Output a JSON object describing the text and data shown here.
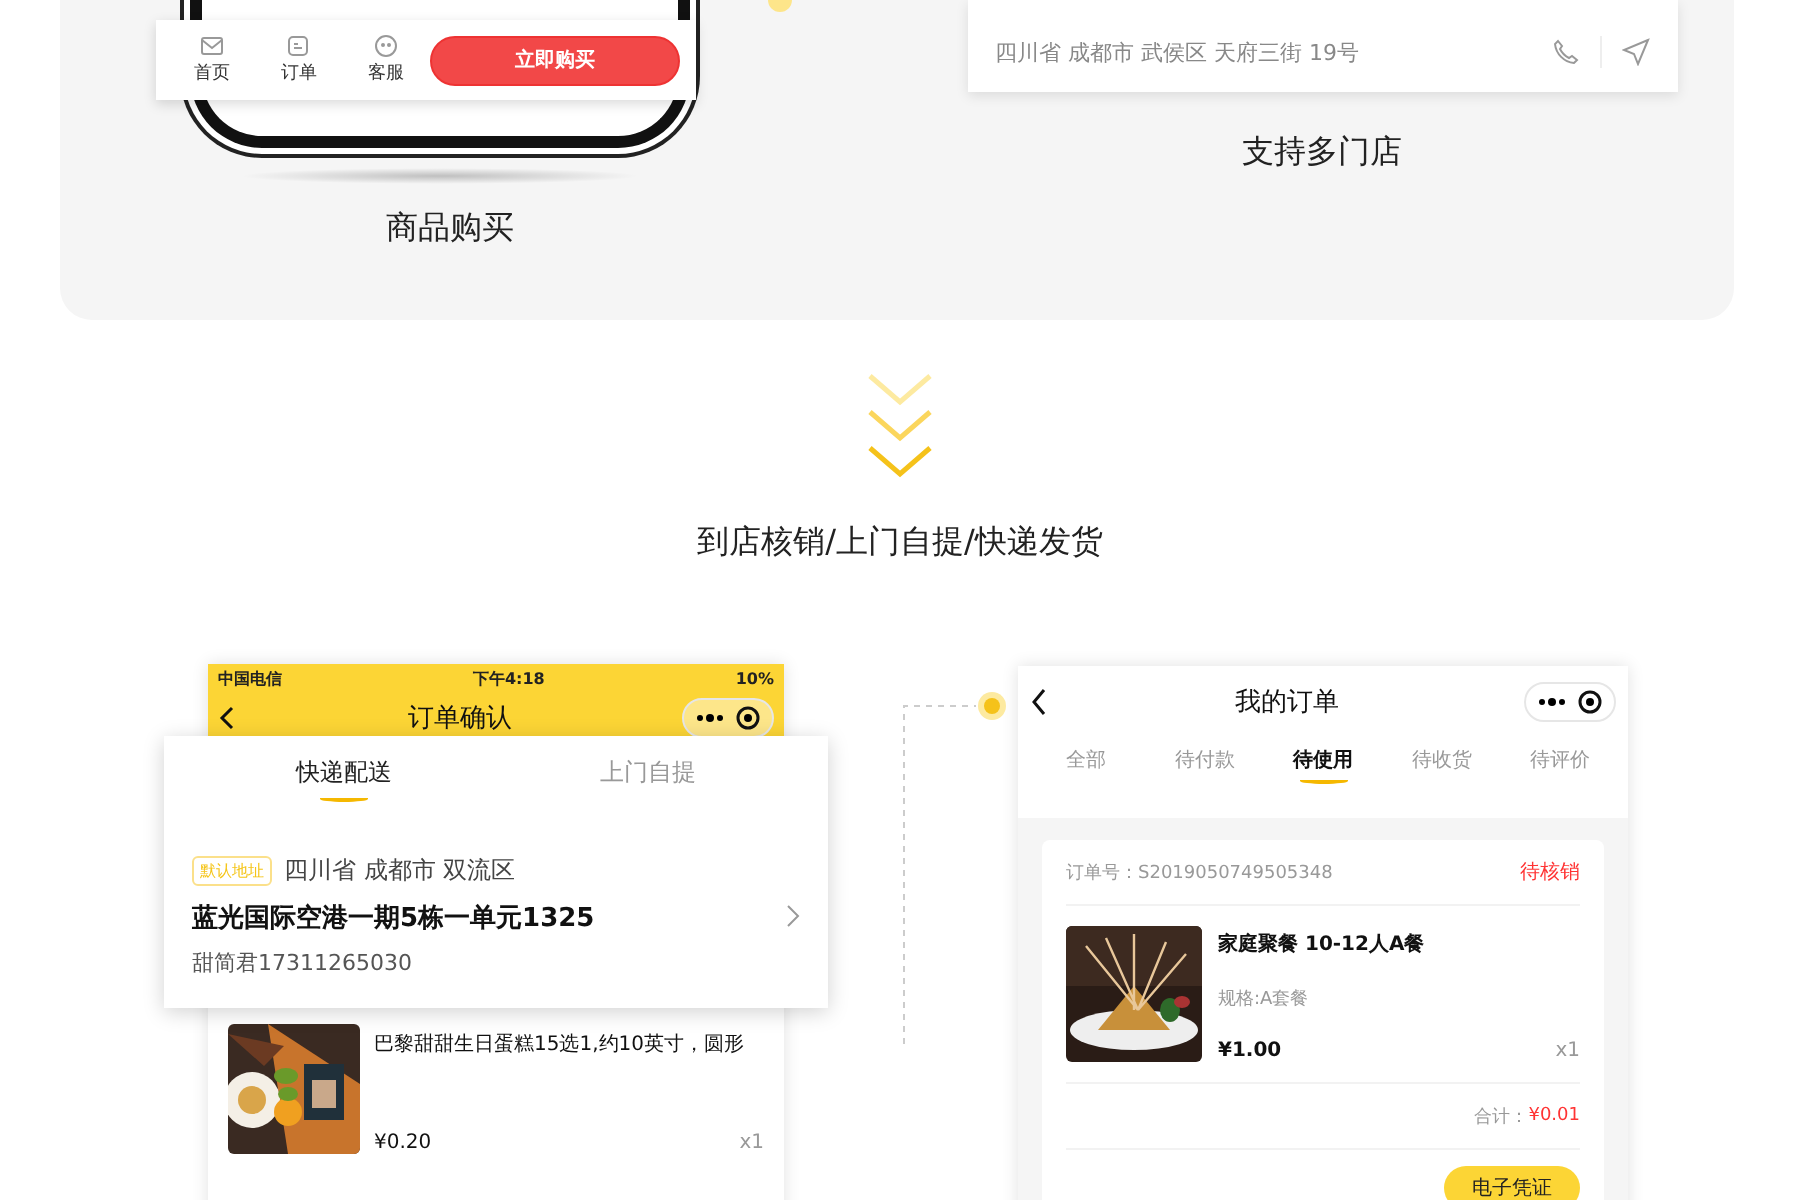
{
  "purchase_bar": {
    "items": [
      {
        "kind": "home",
        "label": "首页"
      },
      {
        "kind": "order",
        "label": "订单"
      },
      {
        "kind": "service",
        "label": "客服"
      }
    ],
    "buy_button": "立即购买"
  },
  "purchase_caption": "商品购买",
  "store_card": {
    "address": "四川省 成都市 武侯区 天府三街 19号"
  },
  "store_caption": "支持多门店",
  "flow_caption": "到店核销/上门自提/快递发货",
  "order_confirm": {
    "status_bar": {
      "carrier": "中国电信",
      "time": "下午4:18",
      "battery": "10%"
    },
    "title": "订单确认",
    "tabs": [
      {
        "label": "快递配送",
        "selected": true
      },
      {
        "label": "上门自提",
        "selected": false
      }
    ],
    "address": {
      "tag": "默认地址",
      "region": "四川省 成都市 双流区",
      "detail": "蓝光国际空港一期5栋一单元1325",
      "contact": "甜简君17311265030"
    },
    "product": {
      "name": "巴黎甜甜生日蛋糕15选1,约10英寸，圆形",
      "price": "¥0.20",
      "quantity": "x1"
    }
  },
  "my_orders": {
    "title": "我的订单",
    "tabs": [
      {
        "label": "全部",
        "selected": false
      },
      {
        "label": "待付款",
        "selected": false
      },
      {
        "label": "待使用",
        "selected": true
      },
      {
        "label": "待收货",
        "selected": false
      },
      {
        "label": "待评价",
        "selected": false
      }
    ],
    "order": {
      "number": "订单号：S2019050749505348",
      "status": "待核销",
      "name": "家庭聚餐 10-12人A餐",
      "spec": "规格:A套餐",
      "price": "¥1.00",
      "quantity": "x1",
      "total_label": "合计：",
      "total": "¥0.01",
      "button": "电子凭证"
    }
  }
}
